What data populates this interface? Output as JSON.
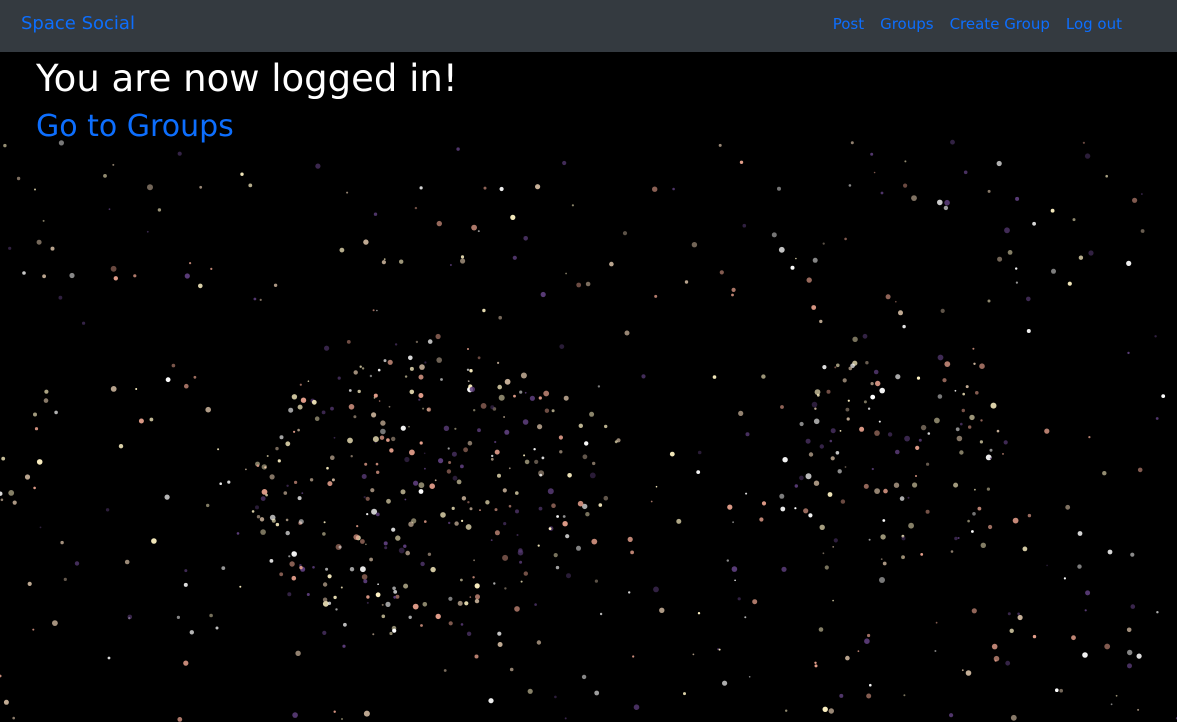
{
  "navbar": {
    "brand": "Space Social",
    "links": [
      {
        "label": "Post"
      },
      {
        "label": "Groups"
      },
      {
        "label": "Create Group"
      },
      {
        "label": "Log out"
      }
    ]
  },
  "main": {
    "title": "You are now logged in!",
    "groups_link": "Go to Groups"
  },
  "colors": {
    "navbar_bg": "#343a40",
    "link": "#0d6efd",
    "background": "#000000",
    "heading": "#ffffff",
    "star_warm": "#fff3c4",
    "star_pink": "#e6a08c",
    "star_purple": "#5a3c78"
  }
}
